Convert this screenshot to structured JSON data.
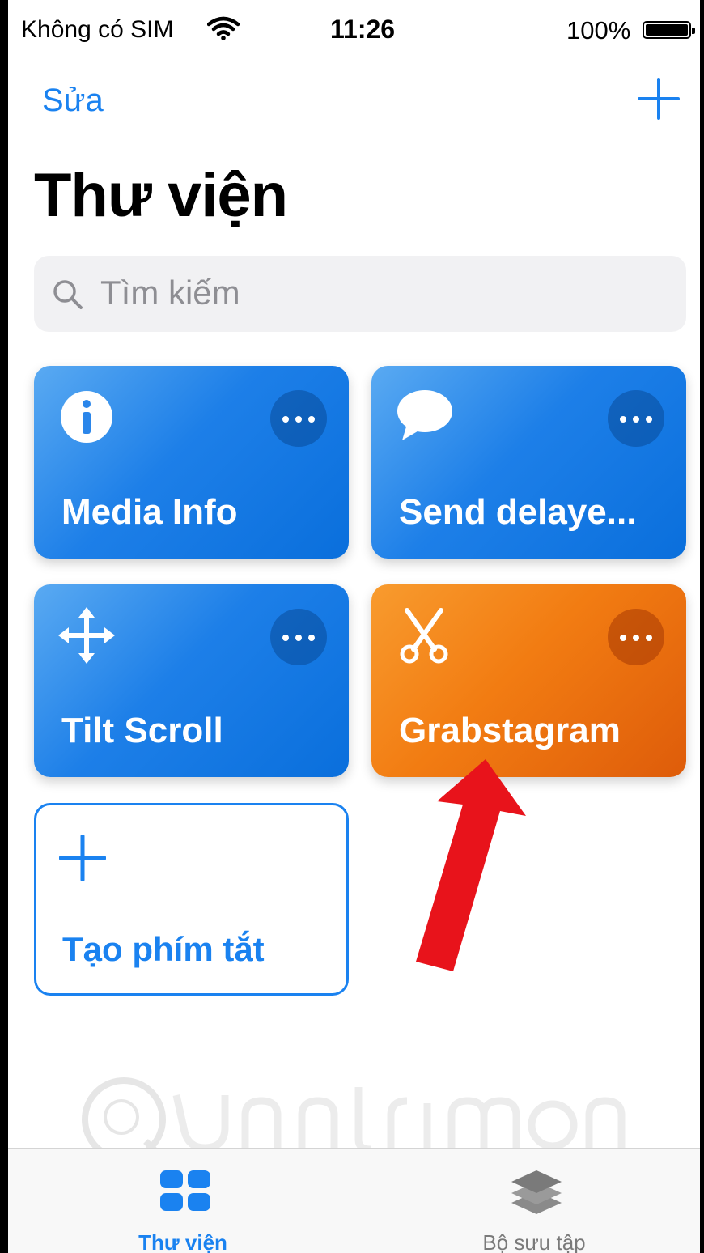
{
  "status_bar": {
    "carrier": "Không có SIM",
    "time": "11:26",
    "battery": "100%"
  },
  "nav": {
    "edit_label": "Sửa",
    "add_icon": "plus-icon"
  },
  "page_title": "Thư viện",
  "search": {
    "placeholder": "Tìm kiếm"
  },
  "shortcuts": [
    {
      "label": "Media Info",
      "icon": "info-icon",
      "color": "#1a7fe6"
    },
    {
      "label": "Send delaye...",
      "icon": "speech-bubble-icon",
      "color": "#1a7fe6"
    },
    {
      "label": "Tilt Scroll",
      "icon": "move-arrows-icon",
      "color": "#1a7fe6"
    },
    {
      "label": "Grabstagram",
      "icon": "scissors-icon",
      "color": "#f27c12"
    }
  ],
  "create_shortcut": {
    "label": "Tạo phím tắt"
  },
  "tabs": [
    {
      "label": "Thư viện",
      "icon": "grid-icon",
      "active": true
    },
    {
      "label": "Bộ sưu tập",
      "icon": "layers-icon",
      "active": false
    }
  ],
  "colors": {
    "accent": "#1a82f0",
    "annotation_arrow": "#e8131b"
  }
}
